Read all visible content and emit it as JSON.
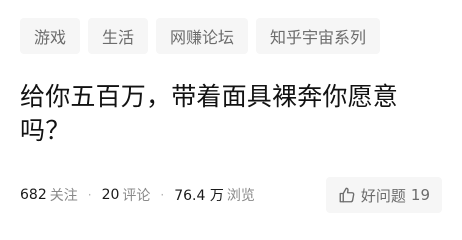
{
  "tags": [
    "游戏",
    "生活",
    "网赚论坛",
    "知乎宇宙系列"
  ],
  "question": {
    "title": "给你五百万，带着面具裸奔你愿意吗？"
  },
  "stats": {
    "followers_num": "682",
    "followers_label": "关注",
    "comments_num": "20",
    "comments_label": "评论",
    "views_num": "76.4 万",
    "views_label": "浏览",
    "separator": "·"
  },
  "good_question": {
    "label": "好问题",
    "count": "19",
    "icon": "thumbs-up-icon"
  },
  "colors": {
    "tag_bg": "#f6f6f6",
    "muted_text": "#8a8a8a",
    "title_text": "#121212"
  }
}
